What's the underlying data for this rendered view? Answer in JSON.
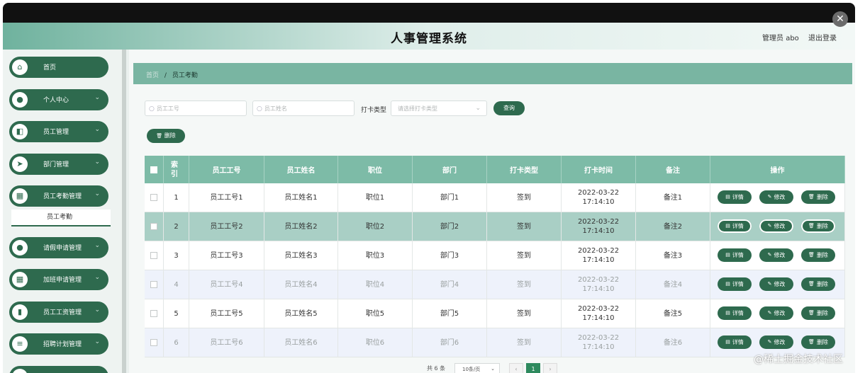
{
  "app": {
    "title": "人事管理系统",
    "user": "管理员 abo",
    "logout": "退出登录",
    "close_glyph": "✕"
  },
  "sidebar": {
    "items": [
      {
        "label": "首页",
        "icon": "home-icon",
        "glyph": "⌂",
        "has_chevron": false
      },
      {
        "label": "个人中心",
        "icon": "person-icon",
        "glyph": "●",
        "has_chevron": true
      },
      {
        "label": "员工管理",
        "icon": "employee-icon",
        "glyph": "◧",
        "has_chevron": true
      },
      {
        "label": "部门管理",
        "icon": "send-icon",
        "glyph": "➤",
        "has_chevron": true
      },
      {
        "label": "员工考勤管理",
        "icon": "grid-icon",
        "glyph": "▦",
        "has_chevron": true
      },
      {
        "label": "请假申请管理",
        "icon": "person-icon",
        "glyph": "●",
        "has_chevron": true
      },
      {
        "label": "加班申请管理",
        "icon": "grid-icon",
        "glyph": "▦",
        "has_chevron": true
      },
      {
        "label": "员工工资管理",
        "icon": "bar-chart-icon",
        "glyph": "▮",
        "has_chevron": true
      },
      {
        "label": "招聘计划管理",
        "icon": "list-icon",
        "glyph": "≡",
        "has_chevron": true
      },
      {
        "label": "员工培训管理",
        "icon": "grid-icon",
        "glyph": "▦",
        "has_chevron": true
      }
    ],
    "submenu_active": "员工考勤",
    "chevron": "⌄"
  },
  "breadcrumb": {
    "home": "首页",
    "sep": "/",
    "current": "员工考勤"
  },
  "filters": {
    "emp_id_placeholder": "员工工号",
    "emp_name_placeholder": "员工姓名",
    "punch_type_label": "打卡类型",
    "punch_type_placeholder": "请选择打卡类型",
    "search_button": "查询",
    "search_glyph": "○",
    "dropdown_glyph": "⌄"
  },
  "toolbar": {
    "delete_button": "删除",
    "delete_glyph": "🗑"
  },
  "table": {
    "columns": [
      "索引",
      "员工工号",
      "员工姓名",
      "职位",
      "部门",
      "打卡类型",
      "打卡时间",
      "备注",
      "操作"
    ],
    "rows": [
      {
        "index": "1",
        "emp_id": "员工工号1",
        "emp_name": "员工姓名1",
        "position": "职位1",
        "dept": "部门1",
        "punch_type": "签到",
        "punch_time": "2022-03-22 17:14:10",
        "note": "备注1"
      },
      {
        "index": "2",
        "emp_id": "员工工号2",
        "emp_name": "员工姓名2",
        "position": "职位2",
        "dept": "部门2",
        "punch_type": "签到",
        "punch_time": "2022-03-22 17:14:10",
        "note": "备注2"
      },
      {
        "index": "3",
        "emp_id": "员工工号3",
        "emp_name": "员工姓名3",
        "position": "职位3",
        "dept": "部门3",
        "punch_type": "签到",
        "punch_time": "2022-03-22 17:14:10",
        "note": "备注3"
      },
      {
        "index": "4",
        "emp_id": "员工工号4",
        "emp_name": "员工姓名4",
        "position": "职位4",
        "dept": "部门4",
        "punch_type": "签到",
        "punch_time": "2022-03-22 17:14:10",
        "note": "备注4"
      },
      {
        "index": "5",
        "emp_id": "员工工号5",
        "emp_name": "员工姓名5",
        "position": "职位5",
        "dept": "部门5",
        "punch_type": "签到",
        "punch_time": "2022-03-22 17:14:10",
        "note": "备注5"
      },
      {
        "index": "6",
        "emp_id": "员工工号6",
        "emp_name": "员工姓名6",
        "position": "职位6",
        "dept": "部门6",
        "punch_type": "签到",
        "punch_time": "2022-03-22 17:14:10",
        "note": "备注6"
      }
    ],
    "actions": {
      "detail": "详情",
      "edit": "修改",
      "delete": "删除",
      "detail_glyph": "▤",
      "edit_glyph": "✎",
      "delete_glyph": "🗑"
    },
    "highlight_row": 1
  },
  "pagination": {
    "total": "共 6 条",
    "page_size": "10条/页",
    "current_page": "1",
    "prev": "‹",
    "next": "›"
  },
  "watermark": "@稀土掘金技术社区",
  "colors": {
    "primary": "#2e6a4e",
    "header_row": "#7dbba7",
    "breadcrumb_bar": "#79b5a2"
  }
}
